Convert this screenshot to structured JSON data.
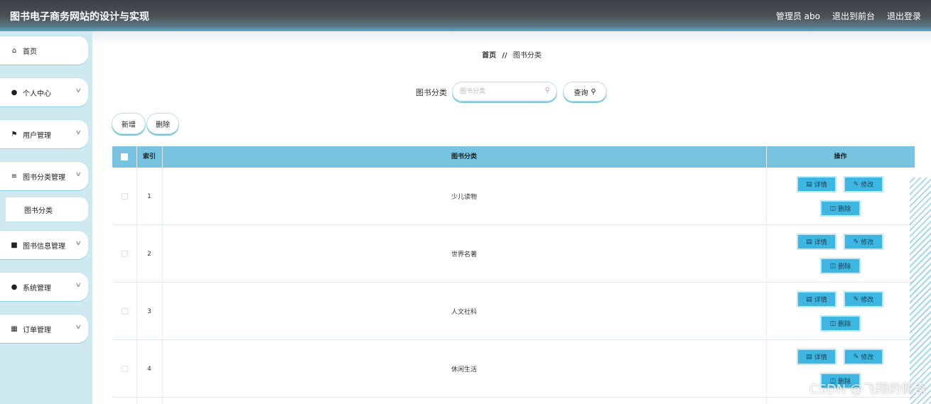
{
  "app": {
    "title": "图书电子商务网站的设计与实现"
  },
  "header": {
    "user": "管理员 abo",
    "to_frontend": "退出到前台",
    "logout": "退出登录"
  },
  "sidebar": {
    "items": [
      {
        "label": "首页",
        "icon": "home-icon"
      },
      {
        "label": "个人中心",
        "icon": "user-icon"
      },
      {
        "label": "用户管理",
        "icon": "flag-icon"
      },
      {
        "label": "图书分类管理",
        "icon": "sliders-icon"
      },
      {
        "label": "图书信息管理",
        "icon": "comment-icon"
      },
      {
        "label": "系统管理",
        "icon": "user-icon"
      },
      {
        "label": "订单管理",
        "icon": "grid-icon"
      }
    ],
    "submenu": {
      "label": "图书分类"
    }
  },
  "breadcrumb": {
    "home": "首页",
    "separator": "//",
    "current": "图书分类"
  },
  "search": {
    "label": "图书分类",
    "placeholder": "图书分类",
    "query_label": "查询"
  },
  "actions": {
    "add": "新增",
    "delete": "删除"
  },
  "table": {
    "headers": {
      "index": "索引",
      "name": "图书分类",
      "ops": "操作"
    },
    "op_labels": {
      "detail": "详情",
      "edit": "修改",
      "delete": "删除"
    },
    "rows": [
      {
        "index": "1",
        "name": "少儿读物"
      },
      {
        "index": "2",
        "name": "世界名著"
      },
      {
        "index": "3",
        "name": "人文社科"
      },
      {
        "index": "4",
        "name": "休闲生活"
      }
    ]
  },
  "watermark": "CSDN @飞翔的佩奇",
  "colors": {
    "header_accent": "#59a9c6",
    "table_header": "#77c3e0",
    "op_button": "#3eb6e2",
    "sidebar_bg": "#cfe9f1"
  }
}
